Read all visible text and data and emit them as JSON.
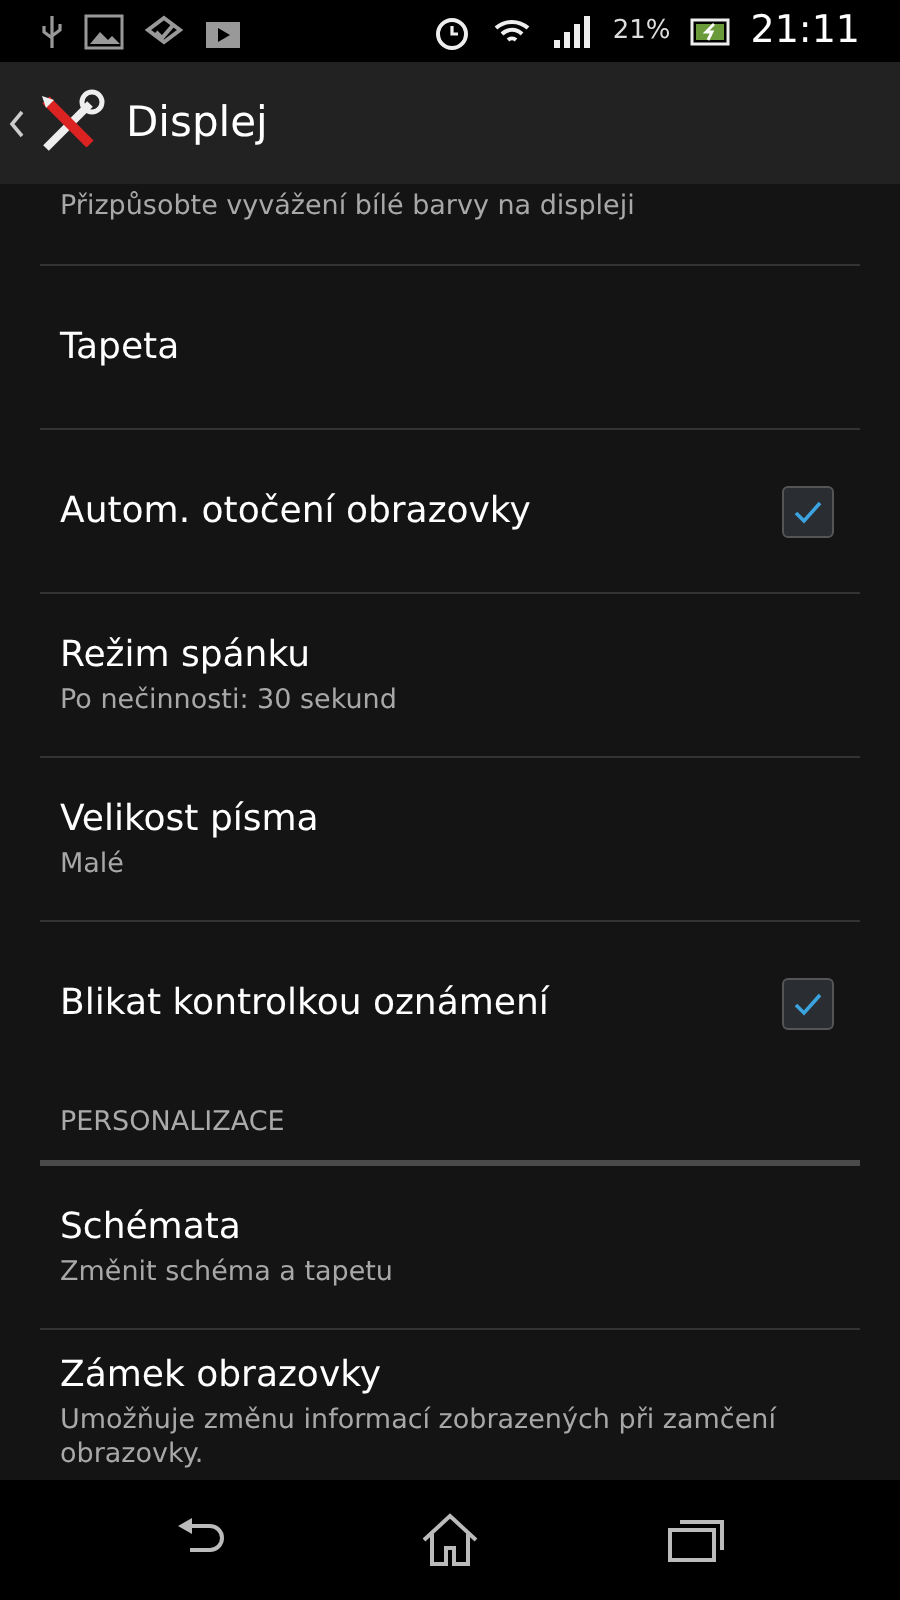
{
  "status_bar": {
    "battery": "21%",
    "time": "21:11"
  },
  "action_bar": {
    "title": "Displej"
  },
  "items": [
    {
      "kind": "partial",
      "subtitle": "Přizpůsobte vyvážení bílé barvy na displeji"
    },
    {
      "kind": "plain",
      "title": "Tapeta"
    },
    {
      "kind": "check",
      "title": "Autom. otočení obrazovky",
      "checked": true
    },
    {
      "kind": "plain",
      "title": "Režim spánku",
      "subtitle": "Po nečinnosti: 30 sekund"
    },
    {
      "kind": "plain",
      "title": "Velikost písma",
      "subtitle": "Malé"
    },
    {
      "kind": "check",
      "title": "Blikat kontrolkou oznámení",
      "checked": true
    },
    {
      "kind": "header",
      "title": "PERSONALIZACE"
    },
    {
      "kind": "plain",
      "title": "Schémata",
      "subtitle": "Změnit schéma a tapetu"
    },
    {
      "kind": "plain",
      "title": "Zámek obrazovky",
      "subtitle": "Umožňuje změnu informací zobrazených při zamčení obrazovky."
    }
  ]
}
